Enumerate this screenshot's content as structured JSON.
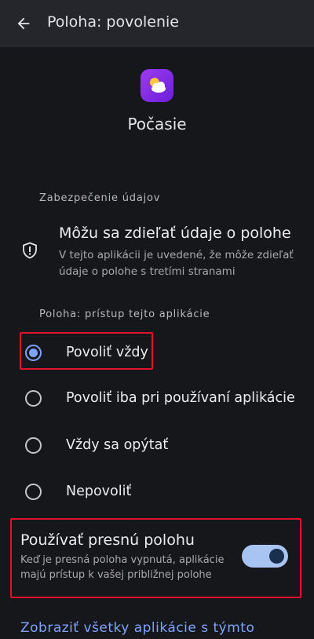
{
  "header": {
    "title": "Poloha: povolenie",
    "back_icon": "arrow-back-icon"
  },
  "app": {
    "name": "Počasie",
    "icon": "weather-icon",
    "icon_color": "#8a2ef0"
  },
  "data_safety": {
    "section_label": "Zabezpečenie údajov",
    "icon": "shield-alert-icon",
    "title": "Môžu sa zdieľať údaje o polohe",
    "description": "V tejto aplikácii je uvedené, že môže zdieľať údaje o polohe s tretími stranami"
  },
  "access": {
    "section_label": "Poloha: prístup tejto aplikácie",
    "options": [
      {
        "label": "Povoliť vždy",
        "selected": true
      },
      {
        "label": "Povoliť iba pri používaní aplikácie",
        "selected": false
      },
      {
        "label": "Vždy sa opýtať",
        "selected": false
      },
      {
        "label": "Nepovoliť",
        "selected": false
      }
    ]
  },
  "precise": {
    "title": "Používať presnú polohu",
    "description": "Keď je presná poloha vypnutá, aplikácie majú prístup k vašej približnej polohe",
    "enabled": true
  },
  "footer_link": "Zobraziť všetky aplikácie s týmto",
  "colors": {
    "accent": "#7ea4ff",
    "highlight": "#e0132a",
    "background": "#16171b"
  }
}
